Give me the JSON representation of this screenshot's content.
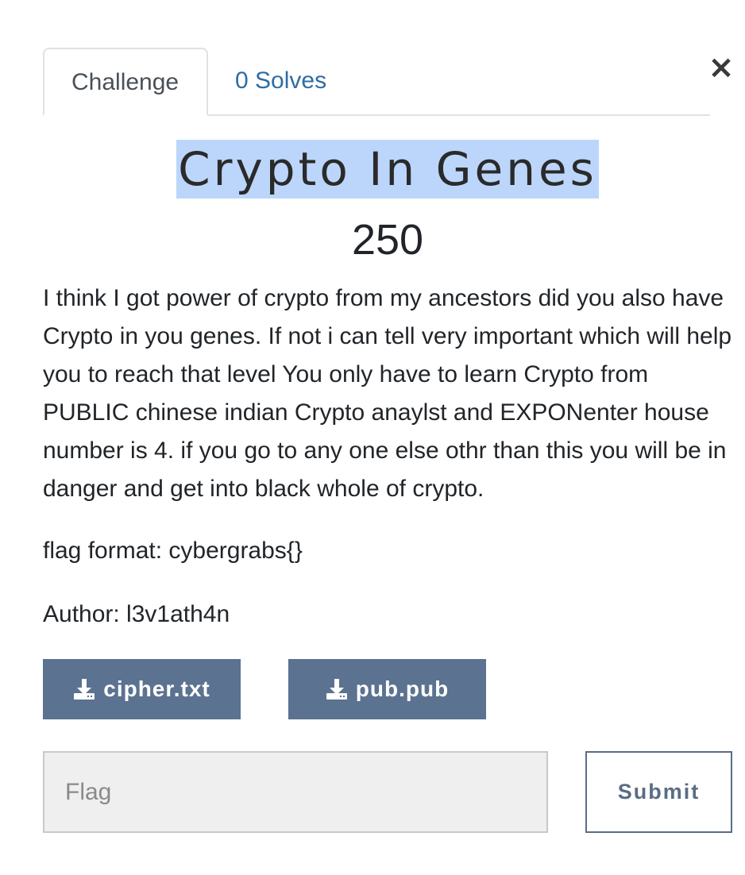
{
  "close": {
    "glyph": "×"
  },
  "tabs": [
    {
      "label": "Challenge",
      "active": true
    },
    {
      "label": "0 Solves",
      "active": false
    }
  ],
  "challenge": {
    "name": "Crypto In Genes",
    "value": "250",
    "description": "I think I got power of crypto from my ancestors did you also have Crypto in you genes. If not i can tell very important which will help you to reach that level You only have to learn Crypto from PUBLIC chinese indian Crypto anaylst and EXPONenter house number is 4. if you go to any one else othr than this you will be in danger and get into black whole of crypto.",
    "flag_format": "flag format: cybergrabs{}",
    "author": "Author: l3v1ath4n"
  },
  "files": [
    {
      "label": "cipher.txt",
      "icon": "download-icon"
    },
    {
      "label": "pub.pub",
      "icon": "download-icon"
    }
  ],
  "flag_input": {
    "placeholder": "Flag",
    "value": ""
  },
  "submit": {
    "label": "Submit"
  },
  "colors": {
    "file_button_bg": "#5b7290",
    "title_highlight": "#bcd6fb",
    "tab_link": "#2e6da4",
    "submit_border": "#5a6d84"
  }
}
